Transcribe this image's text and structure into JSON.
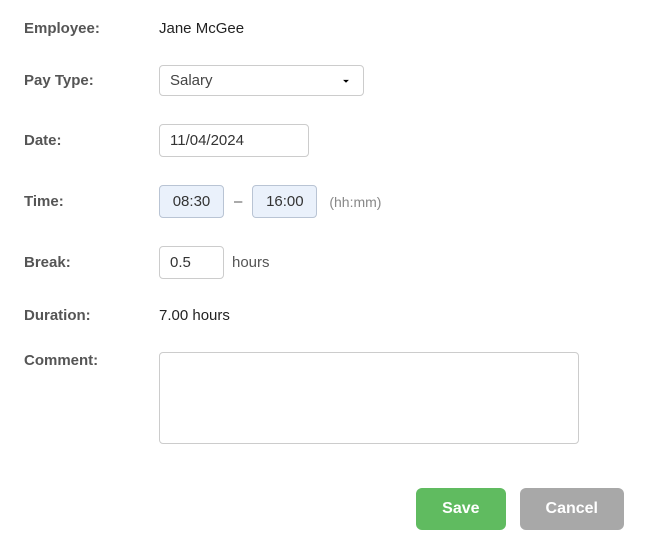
{
  "labels": {
    "employee": "Employee:",
    "pay_type": "Pay Type:",
    "date": "Date:",
    "time": "Time:",
    "break": "Break:",
    "duration": "Duration:",
    "comment": "Comment:"
  },
  "employee": {
    "name": "Jane McGee"
  },
  "pay_type": {
    "selected": "Salary"
  },
  "date": {
    "value": "11/04/2024"
  },
  "time": {
    "start": "08:30",
    "end": "16:00",
    "separator": "–",
    "hint": "(hh:mm)"
  },
  "break": {
    "value": "0.5",
    "unit": "hours"
  },
  "duration": {
    "value": "7.00 hours"
  },
  "comment": {
    "value": ""
  },
  "buttons": {
    "save": "Save",
    "cancel": "Cancel"
  }
}
